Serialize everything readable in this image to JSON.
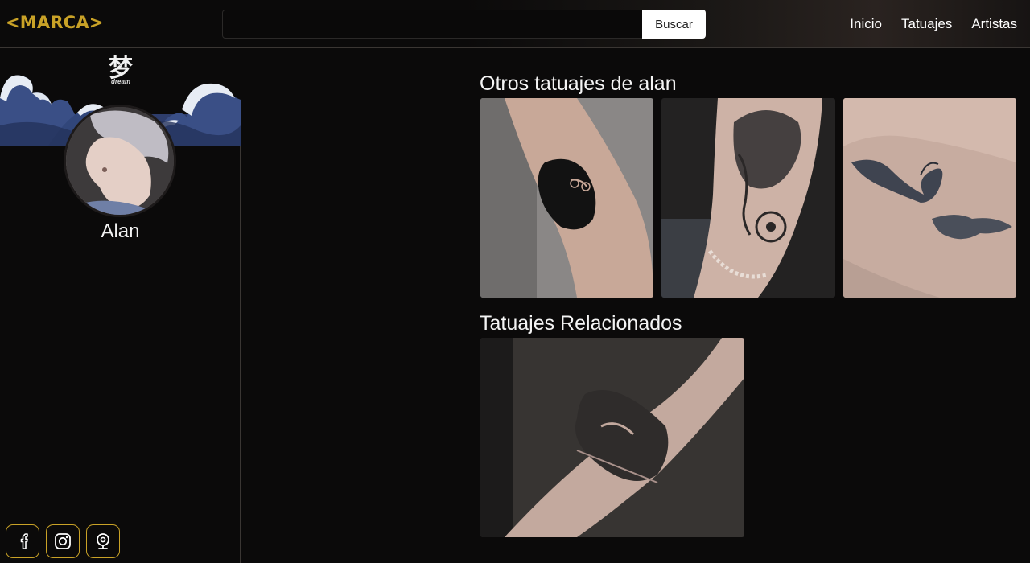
{
  "header": {
    "brand": "<MARCA>",
    "search": {
      "value": "",
      "placeholder": "",
      "button_label": "Buscar"
    },
    "nav": [
      "Inicio",
      "Tatuajes",
      "Artistas"
    ]
  },
  "sidebar": {
    "cover_kanji": "梦",
    "cover_caption": "dream",
    "artist_name": "Alan",
    "socials": [
      "facebook-icon",
      "instagram-icon",
      "webcam-icon"
    ]
  },
  "main": {
    "other_title": "Otros tatuajes de alan",
    "related_title": "Tatuajes Relacionados"
  },
  "colors": {
    "accent": "#c9a227",
    "background": "#0b0a0a"
  }
}
